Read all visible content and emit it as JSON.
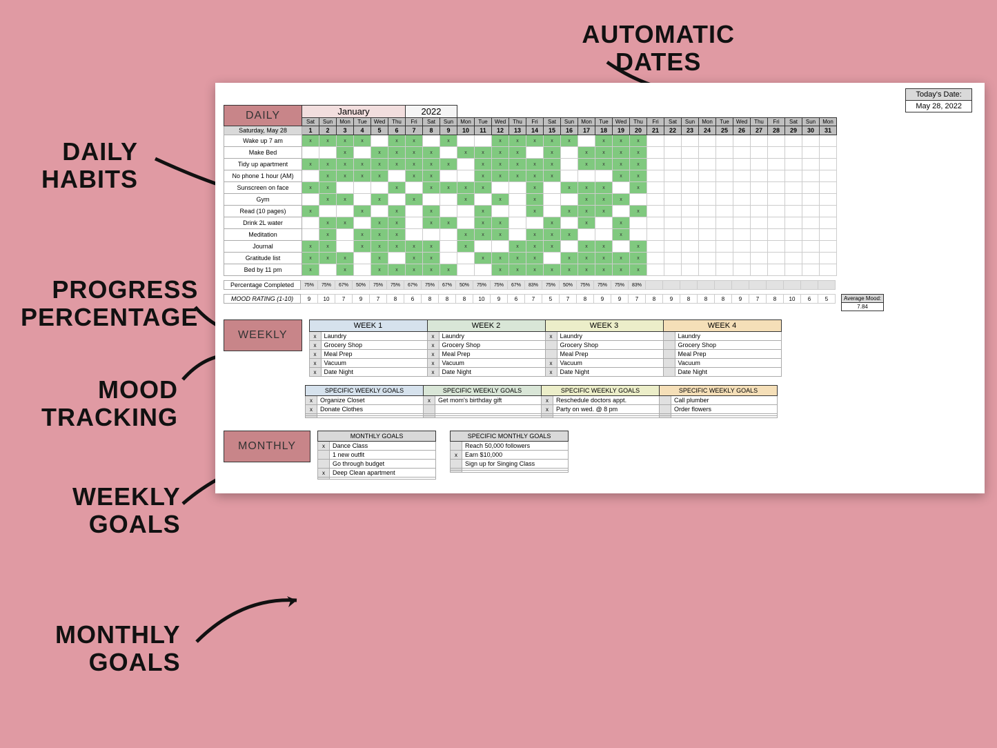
{
  "annotations": {
    "auto_dates": "AUTOMATIC DATES",
    "daily_habits": "DAILY HABITS",
    "progress": "PROGRESS PERCENTAGE",
    "mood": "MOOD TRACKING",
    "weekly_goals": "WEEKLY GOALS",
    "monthly_goals": "MONTHLY GOALS"
  },
  "today": {
    "label": "Today's Date:",
    "value": "May 28, 2022"
  },
  "daily": {
    "header": "DAILY",
    "month": "January",
    "year": "2022",
    "current_day": "Saturday, May 28",
    "dow": [
      "Sat",
      "Sun",
      "Mon",
      "Tue",
      "Wed",
      "Thu",
      "Fri",
      "Sat",
      "Sun",
      "Mon",
      "Tue",
      "Wed",
      "Thu",
      "Fri",
      "Sat",
      "Sun",
      "Mon",
      "Tue",
      "Wed",
      "Thu",
      "Fri",
      "Sat",
      "Sun",
      "Mon",
      "Tue",
      "Wed",
      "Thu",
      "Fri",
      "Sat",
      "Sun",
      "Mon"
    ],
    "days": [
      "1",
      "2",
      "3",
      "4",
      "5",
      "6",
      "7",
      "8",
      "9",
      "10",
      "11",
      "12",
      "13",
      "14",
      "15",
      "16",
      "17",
      "18",
      "19",
      "20",
      "21",
      "22",
      "23",
      "24",
      "25",
      "26",
      "27",
      "28",
      "29",
      "30",
      "31"
    ],
    "habits": [
      {
        "name": "Wake up 7 am",
        "done": [
          1,
          1,
          1,
          1,
          0,
          1,
          1,
          0,
          1,
          0,
          0,
          1,
          1,
          1,
          1,
          1,
          0,
          1,
          1,
          1
        ]
      },
      {
        "name": "Make Bed",
        "done": [
          0,
          0,
          1,
          0,
          1,
          1,
          1,
          1,
          0,
          1,
          1,
          1,
          1,
          0,
          1,
          0,
          1,
          1,
          1,
          1
        ]
      },
      {
        "name": "Tidy up apartment",
        "done": [
          1,
          1,
          1,
          1,
          1,
          1,
          1,
          1,
          1,
          0,
          1,
          1,
          1,
          1,
          1,
          0,
          1,
          1,
          1,
          1
        ]
      },
      {
        "name": "No phone 1 hour (AM)",
        "done": [
          0,
          1,
          1,
          1,
          1,
          0,
          1,
          1,
          0,
          0,
          1,
          1,
          1,
          1,
          1,
          0,
          0,
          0,
          1,
          1
        ]
      },
      {
        "name": "Sunscreen on face",
        "done": [
          1,
          1,
          0,
          0,
          0,
          1,
          0,
          1,
          1,
          1,
          1,
          0,
          0,
          1,
          0,
          1,
          1,
          1,
          0,
          1
        ]
      },
      {
        "name": "Gym",
        "done": [
          0,
          1,
          1,
          0,
          1,
          0,
          1,
          0,
          0,
          1,
          0,
          1,
          0,
          1,
          0,
          0,
          1,
          1,
          1,
          0
        ]
      },
      {
        "name": "Read (10 pages)",
        "done": [
          1,
          0,
          0,
          1,
          0,
          1,
          0,
          1,
          0,
          0,
          1,
          0,
          0,
          1,
          0,
          1,
          1,
          1,
          0,
          1
        ]
      },
      {
        "name": "Drink 2L water",
        "done": [
          0,
          1,
          1,
          0,
          1,
          1,
          0,
          1,
          1,
          0,
          1,
          1,
          0,
          0,
          1,
          0,
          1,
          0,
          1,
          0
        ]
      },
      {
        "name": "Meditation",
        "done": [
          0,
          1,
          0,
          1,
          1,
          1,
          0,
          0,
          0,
          1,
          1,
          1,
          0,
          1,
          1,
          1,
          0,
          0,
          1,
          0
        ]
      },
      {
        "name": "Journal",
        "done": [
          1,
          1,
          0,
          1,
          1,
          1,
          1,
          1,
          0,
          1,
          0,
          0,
          1,
          1,
          1,
          0,
          1,
          1,
          0,
          1
        ]
      },
      {
        "name": "Gratitude list",
        "done": [
          1,
          1,
          1,
          0,
          1,
          0,
          1,
          1,
          0,
          0,
          1,
          1,
          1,
          1,
          0,
          1,
          1,
          1,
          1,
          1
        ]
      },
      {
        "name": "Bed by 11 pm",
        "done": [
          1,
          0,
          1,
          0,
          1,
          1,
          1,
          1,
          1,
          0,
          0,
          1,
          1,
          1,
          1,
          1,
          1,
          1,
          1,
          1
        ]
      }
    ],
    "percentage_label": "Percentage Completed",
    "percentages": [
      "75%",
      "75%",
      "67%",
      "50%",
      "75%",
      "75%",
      "67%",
      "75%",
      "67%",
      "50%",
      "75%",
      "75%",
      "67%",
      "83%",
      "75%",
      "50%",
      "75%",
      "75%",
      "75%",
      "83%"
    ],
    "mood_label": "MOOD RATING (1-10)",
    "moods": [
      "9",
      "10",
      "7",
      "9",
      "7",
      "8",
      "6",
      "8",
      "8",
      "8",
      "10",
      "9",
      "6",
      "7",
      "5",
      "7",
      "8",
      "9",
      "9",
      "7",
      "8",
      "9",
      "8",
      "8",
      "8",
      "9",
      "7",
      "8",
      "10",
      "6",
      "5"
    ],
    "avg_label": "Average Mood:",
    "avg_value": "7.84"
  },
  "weekly": {
    "header": "WEEKLY",
    "weeks": [
      {
        "title": "WEEK 1",
        "tasks": [
          {
            "d": "x",
            "t": "Laundry"
          },
          {
            "d": "x",
            "t": "Grocery Shop"
          },
          {
            "d": "x",
            "t": "Meal Prep"
          },
          {
            "d": "x",
            "t": "Vacuum"
          },
          {
            "d": "x",
            "t": "Date Night"
          }
        ]
      },
      {
        "title": "WEEK 2",
        "tasks": [
          {
            "d": "x",
            "t": "Laundry"
          },
          {
            "d": "x",
            "t": "Grocery Shop"
          },
          {
            "d": "x",
            "t": "Meal Prep"
          },
          {
            "d": "x",
            "t": "Vacuum"
          },
          {
            "d": "x",
            "t": "Date Night"
          }
        ]
      },
      {
        "title": "WEEK 3",
        "tasks": [
          {
            "d": "x",
            "t": "Laundry"
          },
          {
            "d": "",
            "t": "Grocery Shop"
          },
          {
            "d": "",
            "t": "Meal Prep"
          },
          {
            "d": "x",
            "t": "Vacuum"
          },
          {
            "d": "x",
            "t": "Date Night"
          }
        ]
      },
      {
        "title": "WEEK 4",
        "tasks": [
          {
            "d": "",
            "t": "Laundry"
          },
          {
            "d": "",
            "t": "Grocery Shop"
          },
          {
            "d": "",
            "t": "Meal Prep"
          },
          {
            "d": "",
            "t": "Vacuum"
          },
          {
            "d": "",
            "t": "Date Night"
          }
        ]
      }
    ],
    "goals_title": "SPECIFIC WEEKLY GOALS",
    "goals": [
      [
        {
          "d": "x",
          "t": "Organize Closet"
        },
        {
          "d": "x",
          "t": "Donate Clothes"
        },
        {
          "d": "",
          "t": ""
        },
        {
          "d": "",
          "t": ""
        }
      ],
      [
        {
          "d": "x",
          "t": "Get mom's birthday gift"
        },
        {
          "d": "",
          "t": ""
        },
        {
          "d": "",
          "t": ""
        },
        {
          "d": "",
          "t": ""
        }
      ],
      [
        {
          "d": "x",
          "t": "Reschedule doctors appt."
        },
        {
          "d": "x",
          "t": "Party on wed. @ 8 pm"
        },
        {
          "d": "",
          "t": ""
        },
        {
          "d": "",
          "t": ""
        }
      ],
      [
        {
          "d": "",
          "t": "Call plumber"
        },
        {
          "d": "",
          "t": "Order flowers"
        },
        {
          "d": "",
          "t": ""
        },
        {
          "d": "",
          "t": ""
        }
      ]
    ]
  },
  "monthly": {
    "header": "MONTHLY",
    "goals_title": "MONTHLY GOALS",
    "goals": [
      {
        "d": "x",
        "t": "Dance Class"
      },
      {
        "d": "",
        "t": "1 new outfit"
      },
      {
        "d": "",
        "t": "Go through budget"
      },
      {
        "d": "x",
        "t": "Deep Clean apartment"
      },
      {
        "d": "",
        "t": ""
      }
    ],
    "specific_title": "SPECIFIC MONTHLY GOALS",
    "specific": [
      {
        "d": "",
        "t": "Reach 50,000 followers"
      },
      {
        "d": "x",
        "t": "Earn $10,000"
      },
      {
        "d": "",
        "t": "Sign up for Singing Class"
      },
      {
        "d": "",
        "t": ""
      },
      {
        "d": "",
        "t": ""
      }
    ]
  }
}
